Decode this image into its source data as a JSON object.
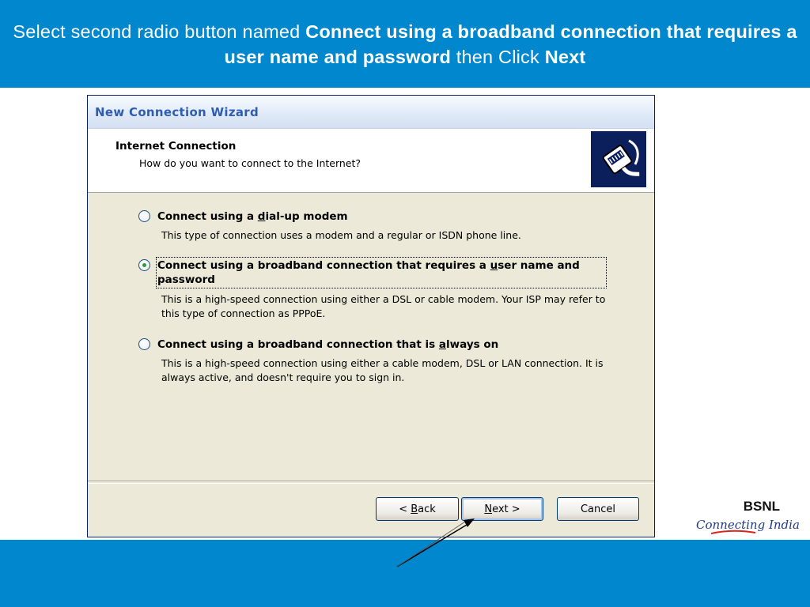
{
  "instruction": {
    "prefix": "Select second radio button named ",
    "option_name": "Connect using a broadband connection that requires a user name and password",
    "middle": " then Click ",
    "button_name": "Next"
  },
  "wizard": {
    "title": "New Connection Wizard",
    "header_title": "Internet Connection",
    "header_subtitle": "How do you want to connect to the Internet?",
    "icon": "network-cable-icon",
    "options": [
      {
        "label_pre": "Connect using a ",
        "label_hotkey": "d",
        "label_post": "ial-up modem",
        "description": "This type of connection uses a modem and a regular or ISDN phone line.",
        "selected": false
      },
      {
        "label_pre": "Connect using a broadband connection that requires a ",
        "label_hotkey": "u",
        "label_post": "ser name and password",
        "description": "This is a high-speed connection using either a DSL or cable modem. Your ISP may refer to this type of connection as PPPoE.",
        "selected": true
      },
      {
        "label_pre": "Connect using a broadband connection that is ",
        "label_hotkey": "a",
        "label_post": "lways on",
        "description": "This is a high-speed connection using either a cable modem, DSL or LAN connection. It is always active, and doesn't require you to sign in.",
        "selected": false
      }
    ],
    "buttons": {
      "back_prefix": "< ",
      "back_hotkey": "B",
      "back_rest": "ack",
      "next_hotkey": "N",
      "next_rest": "ext >",
      "cancel": "Cancel"
    }
  },
  "logo": {
    "brand": "BSNL",
    "tagline": "Connecting India"
  },
  "colors": {
    "banner": "#0087cd",
    "dialog_bg": "#ece9d8",
    "title_text": "#2f5db1"
  }
}
